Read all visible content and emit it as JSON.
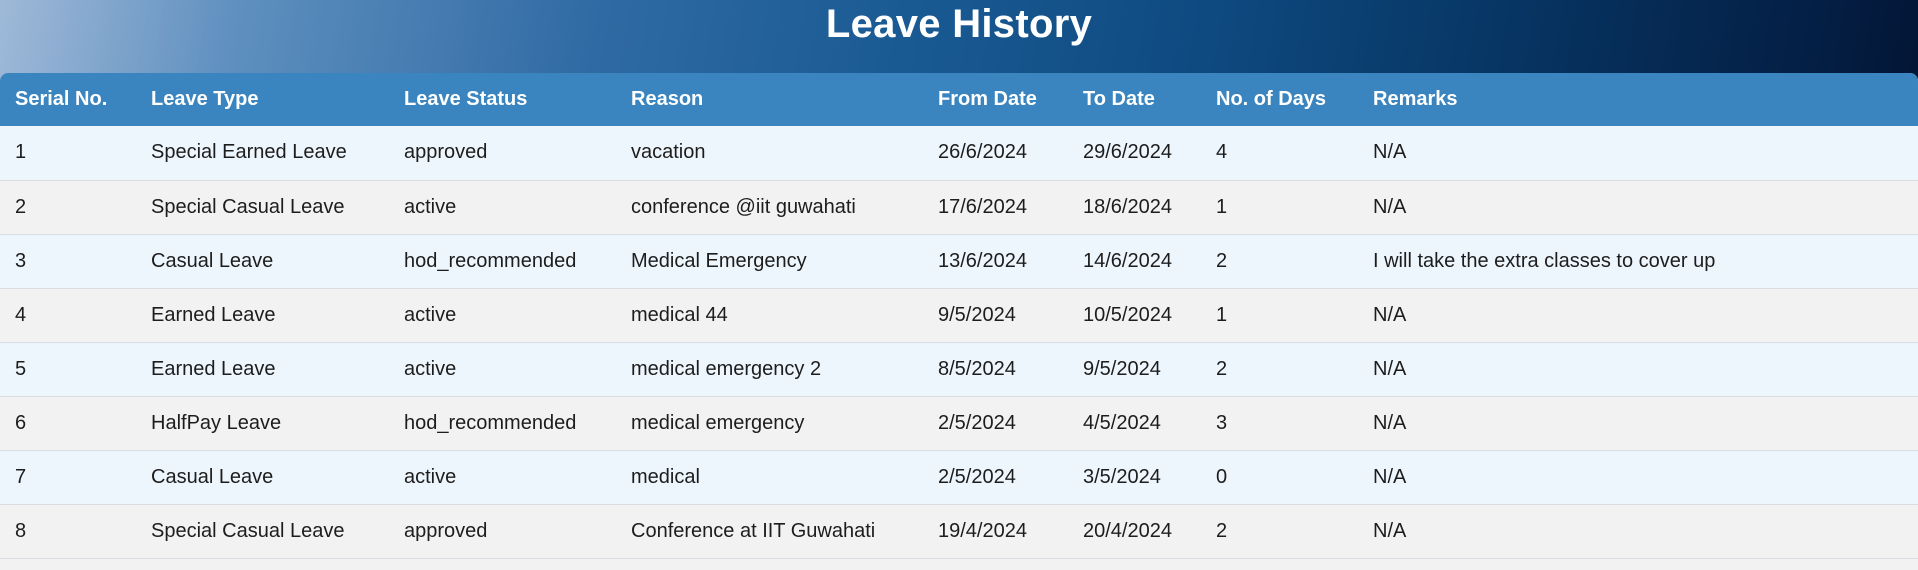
{
  "page": {
    "title": "Leave History"
  },
  "table": {
    "columns": [
      "Serial No.",
      "Leave Type",
      "Leave Status",
      "Reason",
      "From Date",
      "To Date",
      "No. of Days",
      "Remarks"
    ],
    "rows": [
      [
        "1",
        "Special Earned Leave",
        "approved",
        "vacation",
        "26/6/2024",
        "29/6/2024",
        "4",
        "N/A"
      ],
      [
        "2",
        "Special Casual Leave",
        "active",
        "conference @iit guwahati",
        "17/6/2024",
        "18/6/2024",
        "1",
        "N/A"
      ],
      [
        "3",
        "Casual Leave",
        "hod_recommended",
        "Medical Emergency",
        "13/6/2024",
        "14/6/2024",
        "2",
        "I will take the extra classes to cover up"
      ],
      [
        "4",
        "Earned Leave",
        "active",
        "medical 44",
        "9/5/2024",
        "10/5/2024",
        "1",
        "N/A"
      ],
      [
        "5",
        "Earned Leave",
        "active",
        "medical emergency 2",
        "8/5/2024",
        "9/5/2024",
        "2",
        "N/A"
      ],
      [
        "6",
        "HalfPay Leave",
        "hod_recommended",
        "medical emergency",
        "2/5/2024",
        "4/5/2024",
        "3",
        "N/A"
      ],
      [
        "7",
        "Casual Leave",
        "active",
        "medical",
        "2/5/2024",
        "3/5/2024",
        "0",
        "N/A"
      ],
      [
        "8",
        "Special Casual Leave",
        "approved",
        "Conference at IIT Guwahati",
        "19/4/2024",
        "20/4/2024",
        "2",
        "N/A"
      ]
    ]
  }
}
